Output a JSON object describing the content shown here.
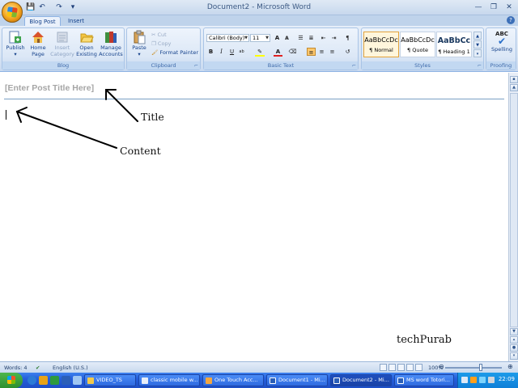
{
  "window": {
    "title": "Document2 - Microsoft Word",
    "controls": {
      "minimize": "—",
      "restore": "❐",
      "close": "✕"
    }
  },
  "quick_access": {
    "save": "💾",
    "undo": "↶",
    "redo": "↷",
    "more": "▾"
  },
  "tabs": [
    {
      "label": "Blog Post",
      "active": true
    },
    {
      "label": "Insert",
      "active": false
    }
  ],
  "help": "?",
  "ribbon": {
    "blog": {
      "label": "Blog",
      "buttons": [
        {
          "label": "Publish",
          "dropdown": "▾",
          "icon": "publish-icon"
        },
        {
          "label": "Home Page",
          "icon": "home-page-icon"
        },
        {
          "label": "Insert Category",
          "icon": "insert-category-icon",
          "disabled": true
        },
        {
          "label": "Open Existing",
          "icon": "open-folder-icon"
        },
        {
          "label": "Manage Accounts",
          "icon": "manage-accounts-icon"
        }
      ]
    },
    "clipboard": {
      "label": "Clipboard",
      "paste": "Paste",
      "paste_dropdown": "▾",
      "cut": "Cut",
      "copy": "Copy",
      "format_painter": "Format Painter",
      "launcher": "⌐"
    },
    "basic_text": {
      "label": "Basic Text",
      "font": "Calibri (Body)",
      "size": "11",
      "grow": "A",
      "shrink": "A",
      "bold": "B",
      "italic": "I",
      "underline": "U",
      "highlight_color": "#ffff00",
      "font_color": "#e02020",
      "launcher": "⌐"
    },
    "styles": {
      "label": "Styles",
      "items": [
        {
          "preview": "AaBbCcDc",
          "name": "¶ Normal",
          "selected": true
        },
        {
          "preview": "AaBbCcDc",
          "name": "¶ Quote",
          "selected": false
        },
        {
          "preview": "AaBbCc",
          "name": "¶ Heading 1",
          "selected": false
        }
      ],
      "launcher": "⌐"
    },
    "proofing": {
      "label": "Proofing",
      "spelling": "Spelling",
      "icon_text": "ABC"
    }
  },
  "document": {
    "post_title_placeholder": "[Enter Post Title Here]",
    "annotations": {
      "title": "Title",
      "content": "Content",
      "watermark": "techPurab"
    }
  },
  "status_bar": {
    "words": "Words: 4",
    "language": "English (U.S.)",
    "zoom": "100%",
    "zoom_out": "⊖",
    "zoom_in": "⊕"
  },
  "taskbar": {
    "start": "Start",
    "tasks": [
      {
        "label": "VIDEO_TS",
        "icon_color": "#f2c94c",
        "active": false
      },
      {
        "label": "classic mobile w...",
        "icon_color": "#e8eef8",
        "active": false
      },
      {
        "label": "One Touch Acc...",
        "icon_color": "#f3a640",
        "active": false
      },
      {
        "label": "Document1 - Mi...",
        "icon_color": "#2b5fb8",
        "active": false
      },
      {
        "label": "Document2 - Mi...",
        "icon_color": "#2b5fb8",
        "active": true
      },
      {
        "label": "MS word Totori...",
        "icon_color": "#2b5fb8",
        "active": false
      }
    ],
    "clock": "22:09"
  }
}
